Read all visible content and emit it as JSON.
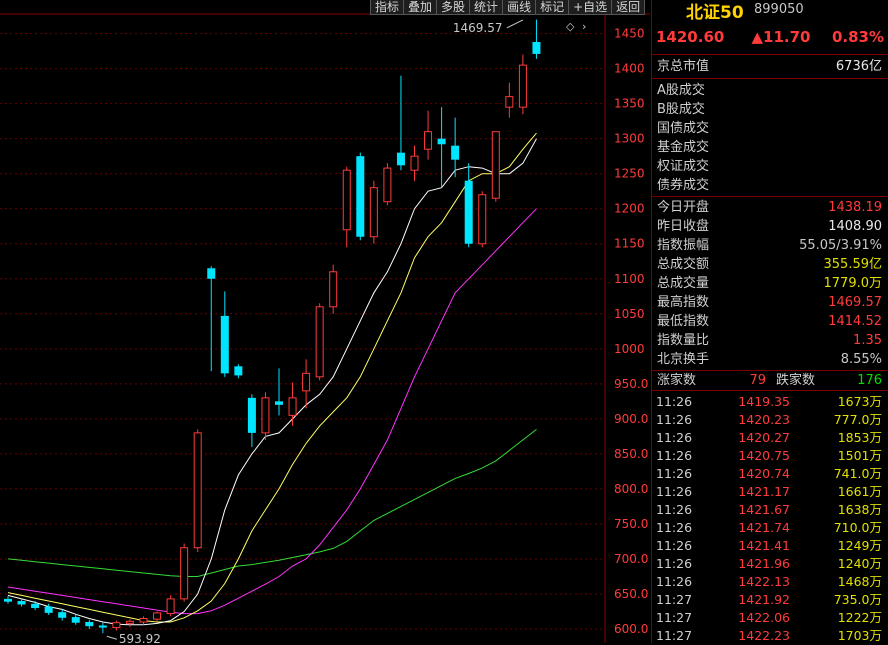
{
  "toolbar": [
    "指标",
    "叠加",
    "多股",
    "统计",
    "画线",
    "标记",
    "+自选",
    "返回"
  ],
  "header": {
    "name": "北证50",
    "code": "899050"
  },
  "quote": {
    "price": "1420.60",
    "change": "▲11.70",
    "pct": "0.83%"
  },
  "market_cap": {
    "label": "京总市值",
    "value": "6736亿"
  },
  "volume_labels": [
    "A股成交",
    "B股成交",
    "国债成交",
    "基金成交",
    "权证成交",
    "债券成交"
  ],
  "stats": [
    {
      "label": "今日开盘",
      "value": "1438.19",
      "color": "#ff3b3b"
    },
    {
      "label": "昨日收盘",
      "value": "1408.90",
      "color": "#e8e8e8"
    },
    {
      "label": "指数振幅",
      "value": "55.05/3.91%",
      "color": "#c8c8c8"
    },
    {
      "label": "总成交额",
      "value": "355.59亿",
      "color": "#e0e000"
    },
    {
      "label": "总成交量",
      "value": "1779.0万",
      "color": "#e0e000"
    },
    {
      "label": "最高指数",
      "value": "1469.57",
      "color": "#ff3b3b"
    },
    {
      "label": "最低指数",
      "value": "1414.52",
      "color": "#ff3b3b"
    },
    {
      "label": "指数量比",
      "value": "1.35",
      "color": "#ff3b3b"
    },
    {
      "label": "北京换手",
      "value": "8.55%",
      "color": "#c8c8c8"
    }
  ],
  "breadth": {
    "up_label": "涨家数",
    "up": "79",
    "down_label": "跌家数",
    "down": "176"
  },
  "trades": [
    [
      "11:26",
      "1419.35",
      "1673万"
    ],
    [
      "11:26",
      "1420.23",
      "777.0万"
    ],
    [
      "11:26",
      "1420.27",
      "1853万"
    ],
    [
      "11:26",
      "1420.75",
      "1501万"
    ],
    [
      "11:26",
      "1420.74",
      "741.0万"
    ],
    [
      "11:26",
      "1421.17",
      "1661万"
    ],
    [
      "11:26",
      "1421.67",
      "1638万"
    ],
    [
      "11:26",
      "1421.74",
      "710.0万"
    ],
    [
      "11:26",
      "1421.41",
      "1249万"
    ],
    [
      "11:26",
      "1421.96",
      "1240万"
    ],
    [
      "11:26",
      "1422.13",
      "1468万"
    ],
    [
      "11:27",
      "1421.92",
      "735.0万"
    ],
    [
      "11:27",
      "1422.06",
      "1222万"
    ],
    [
      "11:27",
      "1422.23",
      "1703万"
    ]
  ],
  "chart_data": {
    "type": "candlestick",
    "y_ticks": [
      "1450",
      "1400",
      "1350",
      "1300",
      "1250",
      "1200",
      "1150",
      "1100",
      "1050",
      "1000",
      "950.0",
      "900.0",
      "850.0",
      "800.0",
      "750.0",
      "700.0",
      "650.0",
      "600.0"
    ],
    "ylim": [
      580,
      1478
    ],
    "annotations": [
      {
        "text": "1469.57",
        "value": 1469.57,
        "index": 38
      },
      {
        "text": "593.92",
        "value": 593.92,
        "index": 7
      }
    ],
    "colors": {
      "up": "#ff3b3b",
      "down": "#00e5ff",
      "ma5": "#ffffff",
      "ma10": "#ffff66",
      "ma20": "#ff33ff",
      "ma60": "#33dd33"
    },
    "candles": [
      {
        "o": 643,
        "h": 647,
        "l": 636,
        "c": 639
      },
      {
        "o": 640,
        "h": 644,
        "l": 632,
        "c": 635
      },
      {
        "o": 636,
        "h": 640,
        "l": 627,
        "c": 630
      },
      {
        "o": 632,
        "h": 636,
        "l": 620,
        "c": 623
      },
      {
        "o": 624,
        "h": 628,
        "l": 612,
        "c": 616
      },
      {
        "o": 617,
        "h": 621,
        "l": 606,
        "c": 609
      },
      {
        "o": 610,
        "h": 613,
        "l": 600,
        "c": 604
      },
      {
        "o": 605,
        "h": 609,
        "l": 594,
        "c": 602
      },
      {
        "o": 602,
        "h": 612,
        "l": 598,
        "c": 609
      },
      {
        "o": 608,
        "h": 614,
        "l": 603,
        "c": 611
      },
      {
        "o": 610,
        "h": 618,
        "l": 606,
        "c": 615
      },
      {
        "o": 614,
        "h": 625,
        "l": 611,
        "c": 623
      },
      {
        "o": 622,
        "h": 648,
        "l": 618,
        "c": 643
      },
      {
        "o": 643,
        "h": 722,
        "l": 639,
        "c": 716
      },
      {
        "o": 716,
        "h": 885,
        "l": 710,
        "c": 880
      },
      {
        "o": 1115,
        "h": 1118,
        "l": 968,
        "c": 1100
      },
      {
        "o": 1047,
        "h": 1082,
        "l": 960,
        "c": 965
      },
      {
        "o": 975,
        "h": 978,
        "l": 958,
        "c": 962
      },
      {
        "o": 930,
        "h": 935,
        "l": 860,
        "c": 880
      },
      {
        "o": 880,
        "h": 938,
        "l": 870,
        "c": 930
      },
      {
        "o": 925,
        "h": 972,
        "l": 905,
        "c": 920
      },
      {
        "o": 905,
        "h": 952,
        "l": 890,
        "c": 930
      },
      {
        "o": 940,
        "h": 985,
        "l": 915,
        "c": 965
      },
      {
        "o": 960,
        "h": 1065,
        "l": 955,
        "c": 1060
      },
      {
        "o": 1060,
        "h": 1120,
        "l": 1050,
        "c": 1110
      },
      {
        "o": 1170,
        "h": 1260,
        "l": 1145,
        "c": 1255
      },
      {
        "o": 1275,
        "h": 1280,
        "l": 1155,
        "c": 1160
      },
      {
        "o": 1160,
        "h": 1240,
        "l": 1150,
        "c": 1230
      },
      {
        "o": 1210,
        "h": 1265,
        "l": 1205,
        "c": 1258
      },
      {
        "o": 1280,
        "h": 1390,
        "l": 1255,
        "c": 1262
      },
      {
        "o": 1255,
        "h": 1290,
        "l": 1240,
        "c": 1275
      },
      {
        "o": 1285,
        "h": 1340,
        "l": 1270,
        "c": 1310
      },
      {
        "o": 1300,
        "h": 1345,
        "l": 1230,
        "c": 1292
      },
      {
        "o": 1290,
        "h": 1330,
        "l": 1245,
        "c": 1270
      },
      {
        "o": 1240,
        "h": 1265,
        "l": 1145,
        "c": 1150
      },
      {
        "o": 1150,
        "h": 1225,
        "l": 1145,
        "c": 1220
      },
      {
        "o": 1215,
        "h": 1310,
        "l": 1210,
        "c": 1310
      },
      {
        "o": 1345,
        "h": 1380,
        "l": 1330,
        "c": 1360
      },
      {
        "o": 1345,
        "h": 1420,
        "l": 1335,
        "c": 1405
      },
      {
        "o": 1438,
        "h": 1470,
        "l": 1414,
        "c": 1421
      }
    ],
    "ma5": [
      648,
      643,
      638,
      632,
      628,
      621,
      615,
      610,
      607,
      606,
      606,
      608,
      612,
      625,
      650,
      700,
      770,
      820,
      850,
      875,
      880,
      900,
      920,
      935,
      960,
      1000,
      1040,
      1080,
      1110,
      1150,
      1200,
      1225,
      1230,
      1255,
      1260,
      1258,
      1250,
      1250,
      1265,
      1300
    ],
    "ma10": [
      652,
      648,
      644,
      640,
      636,
      632,
      628,
      624,
      620,
      616,
      612,
      610,
      610,
      616,
      626,
      640,
      665,
      700,
      740,
      770,
      800,
      835,
      865,
      890,
      910,
      930,
      960,
      1000,
      1040,
      1080,
      1130,
      1160,
      1180,
      1210,
      1240,
      1250,
      1250,
      1260,
      1285,
      1308
    ],
    "ma20": [
      660,
      657,
      654,
      651,
      648,
      645,
      642,
      639,
      636,
      633,
      630,
      627,
      624,
      622,
      622,
      626,
      634,
      644,
      654,
      664,
      675,
      690,
      700,
      720,
      745,
      770,
      800,
      835,
      870,
      915,
      960,
      1000,
      1040,
      1080,
      1100,
      1120,
      1140,
      1160,
      1180,
      1200
    ],
    "ma60": [
      700,
      698,
      696,
      694,
      692,
      690,
      688,
      686,
      684,
      682,
      680,
      678,
      676,
      675,
      675,
      680,
      685,
      690,
      692,
      695,
      698,
      702,
      706,
      710,
      715,
      725,
      740,
      755,
      765,
      775,
      785,
      795,
      805,
      815,
      822,
      830,
      840,
      855,
      870,
      885
    ]
  }
}
